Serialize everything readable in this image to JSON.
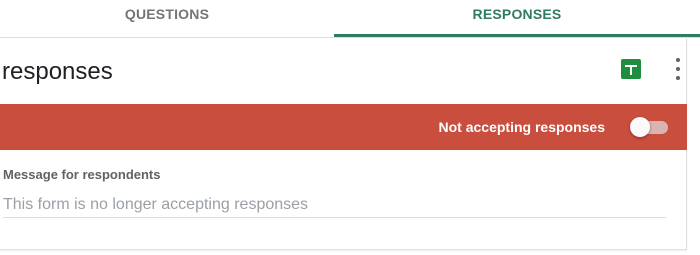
{
  "tabs": [
    {
      "label": "QUESTIONS",
      "active": false
    },
    {
      "label": "RESPONSES",
      "active": true
    }
  ],
  "card": {
    "title": "responses",
    "actions": {
      "sheets_icon": "google-sheets-icon",
      "more_icon": "more-vert-icon"
    },
    "banner": {
      "label": "Not accepting responses",
      "toggle_on": false,
      "color": "#c94e3e"
    },
    "message": {
      "label": "Message for respondents",
      "value": "",
      "placeholder": "This form is no longer accepting responses"
    }
  },
  "colors": {
    "accent": "#2e7d61",
    "banner": "#c94e3e"
  }
}
